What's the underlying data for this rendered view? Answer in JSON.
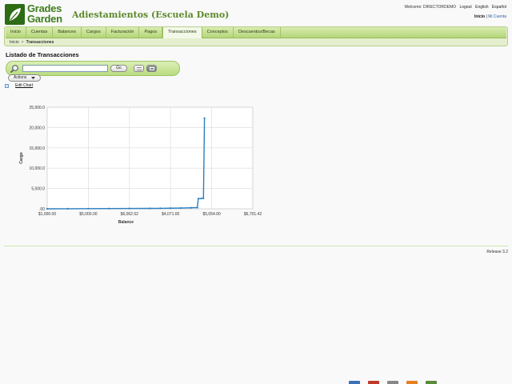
{
  "header": {
    "logo_line1": "Grades",
    "logo_line2": "Garden",
    "site_title": "Adiestamientos (Escuela Demo)",
    "welcome": "Welcome: DIRECTORDEMO",
    "logout": "Logout",
    "lang_english": "English",
    "lang_spanish": "Español",
    "home": "Inicio",
    "separator": "|",
    "my_account": "Mi Cuenta"
  },
  "menu": {
    "tabs": [
      {
        "label": "Inicio"
      },
      {
        "label": "Cuentas"
      },
      {
        "label": "Balances"
      },
      {
        "label": "Cargos"
      },
      {
        "label": "Facturación"
      },
      {
        "label": "Pagos"
      },
      {
        "label": "Transacciones"
      },
      {
        "label": "Conceptos"
      },
      {
        "label": "Descuentos/Becas"
      }
    ],
    "active_index": 6
  },
  "breadcrumb": {
    "home": "Inicio",
    "sep": ">",
    "current": "Transacciones"
  },
  "page": {
    "title": "Listado de Transacciones"
  },
  "search": {
    "value": "",
    "go_label": "Go"
  },
  "actions": {
    "label": "Actions"
  },
  "edit_chart": {
    "label": "Edit Chart"
  },
  "chart_data": {
    "type": "line",
    "xlabel": "Balance",
    "ylabel": "Cargo",
    "x_ticks": [
      "-5,550.00",
      "-3,300.00",
      "-1,650.00",
      "0.00",
      "1,650.00",
      "3,300.00"
    ],
    "x_tick_labels": [
      "$1,000.00",
      "$5,000.00",
      "$6,062.52",
      "$4,071.00",
      "$5,054.00",
      "$6,701.42"
    ],
    "y_ticks": [
      0,
      5000,
      10000,
      15000,
      20000,
      25000
    ],
    "y_tick_labels": [
      ".00",
      "5,000.0",
      "10,000.0",
      "15,000.0",
      "20,000.0",
      "25,000.0"
    ],
    "xlim": [
      0,
      100
    ],
    "ylim": [
      0,
      25000
    ],
    "grid": true,
    "line_color": "#2b7fc1",
    "series": [
      {
        "x": [
          0,
          10,
          20,
          30,
          40,
          50,
          55,
          60,
          65,
          70,
          73,
          73.5,
          75,
          76,
          76.5
        ],
        "y": [
          0,
          20,
          40,
          60,
          80,
          100,
          120,
          150,
          180,
          250,
          300,
          2500,
          2550,
          2600,
          22300
        ]
      }
    ]
  },
  "footer": {
    "release": "Release 3.2"
  },
  "colors": {
    "brand_green": "#3f7d1d",
    "menu_green": "#b5d67a"
  }
}
